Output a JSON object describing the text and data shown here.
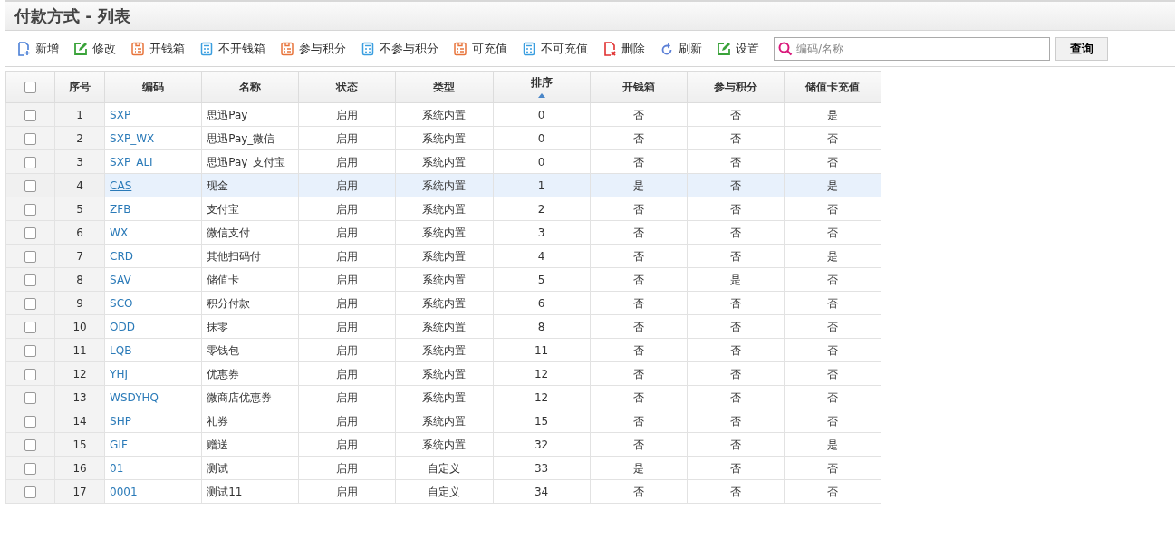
{
  "title": "付款方式 - 列表",
  "toolbar": [
    {
      "label": "新增",
      "kind": "add"
    },
    {
      "label": "修改",
      "kind": "edit"
    },
    {
      "label": "开钱箱",
      "kind": "orange-list"
    },
    {
      "label": "不开钱箱",
      "kind": "blue-calc"
    },
    {
      "label": "参与积分",
      "kind": "orange-list"
    },
    {
      "label": "不参与积分",
      "kind": "blue-calc"
    },
    {
      "label": "可充值",
      "kind": "orange-list"
    },
    {
      "label": "不可充值",
      "kind": "blue-calc"
    },
    {
      "label": "删除",
      "kind": "delete"
    },
    {
      "label": "刷新",
      "kind": "refresh"
    },
    {
      "label": "设置",
      "kind": "edit"
    }
  ],
  "search": {
    "placeholder": "编码/名称",
    "button": "查询"
  },
  "table": {
    "select_all_checked": false,
    "columns": [
      "序号",
      "编码",
      "名称",
      "状态",
      "类型",
      "排序",
      "开钱箱",
      "参与积分",
      "储值卡充值"
    ],
    "rows": [
      {
        "selected": false,
        "checked": false,
        "cells": [
          "1",
          "SXP",
          "思迅Pay",
          "启用",
          "系统内置",
          "0",
          "否",
          "否",
          "是"
        ]
      },
      {
        "selected": false,
        "checked": false,
        "cells": [
          "2",
          "SXP_WX",
          "思迅Pay_微信",
          "启用",
          "系统内置",
          "0",
          "否",
          "否",
          "否"
        ]
      },
      {
        "selected": false,
        "checked": false,
        "cells": [
          "3",
          "SXP_ALI",
          "思迅Pay_支付宝",
          "启用",
          "系统内置",
          "0",
          "否",
          "否",
          "否"
        ]
      },
      {
        "selected": true,
        "checked": false,
        "cells": [
          "4",
          "CAS",
          "现金",
          "启用",
          "系统内置",
          "1",
          "是",
          "否",
          "是"
        ]
      },
      {
        "selected": false,
        "checked": false,
        "cells": [
          "5",
          "ZFB",
          "支付宝",
          "启用",
          "系统内置",
          "2",
          "否",
          "否",
          "否"
        ]
      },
      {
        "selected": false,
        "checked": false,
        "cells": [
          "6",
          "WX",
          "微信支付",
          "启用",
          "系统内置",
          "3",
          "否",
          "否",
          "否"
        ]
      },
      {
        "selected": false,
        "checked": false,
        "cells": [
          "7",
          "CRD",
          "其他扫码付",
          "启用",
          "系统内置",
          "4",
          "否",
          "否",
          "是"
        ]
      },
      {
        "selected": false,
        "checked": false,
        "cells": [
          "8",
          "SAV",
          "储值卡",
          "启用",
          "系统内置",
          "5",
          "否",
          "是",
          "否"
        ]
      },
      {
        "selected": false,
        "checked": false,
        "cells": [
          "9",
          "SCO",
          "积分付款",
          "启用",
          "系统内置",
          "6",
          "否",
          "否",
          "否"
        ]
      },
      {
        "selected": false,
        "checked": false,
        "cells": [
          "10",
          "ODD",
          "抹零",
          "启用",
          "系统内置",
          "8",
          "否",
          "否",
          "否"
        ]
      },
      {
        "selected": false,
        "checked": false,
        "cells": [
          "11",
          "LQB",
          "零钱包",
          "启用",
          "系统内置",
          "11",
          "否",
          "否",
          "否"
        ]
      },
      {
        "selected": false,
        "checked": false,
        "cells": [
          "12",
          "YHJ",
          "优惠券",
          "启用",
          "系统内置",
          "12",
          "否",
          "否",
          "否"
        ]
      },
      {
        "selected": false,
        "checked": false,
        "cells": [
          "13",
          "WSDYHQ",
          "微商店优惠券",
          "启用",
          "系统内置",
          "12",
          "否",
          "否",
          "否"
        ]
      },
      {
        "selected": false,
        "checked": false,
        "cells": [
          "14",
          "SHP",
          "礼券",
          "启用",
          "系统内置",
          "15",
          "否",
          "否",
          "否"
        ]
      },
      {
        "selected": false,
        "checked": false,
        "cells": [
          "15",
          "GIF",
          "赠送",
          "启用",
          "系统内置",
          "32",
          "否",
          "否",
          "是"
        ]
      },
      {
        "selected": false,
        "checked": false,
        "cells": [
          "16",
          "01",
          "测试",
          "启用",
          "自定义",
          "33",
          "是",
          "否",
          "否"
        ]
      },
      {
        "selected": false,
        "checked": false,
        "cells": [
          "17",
          "0001",
          "测试11",
          "启用",
          "自定义",
          "34",
          "否",
          "否",
          "否"
        ]
      }
    ]
  }
}
